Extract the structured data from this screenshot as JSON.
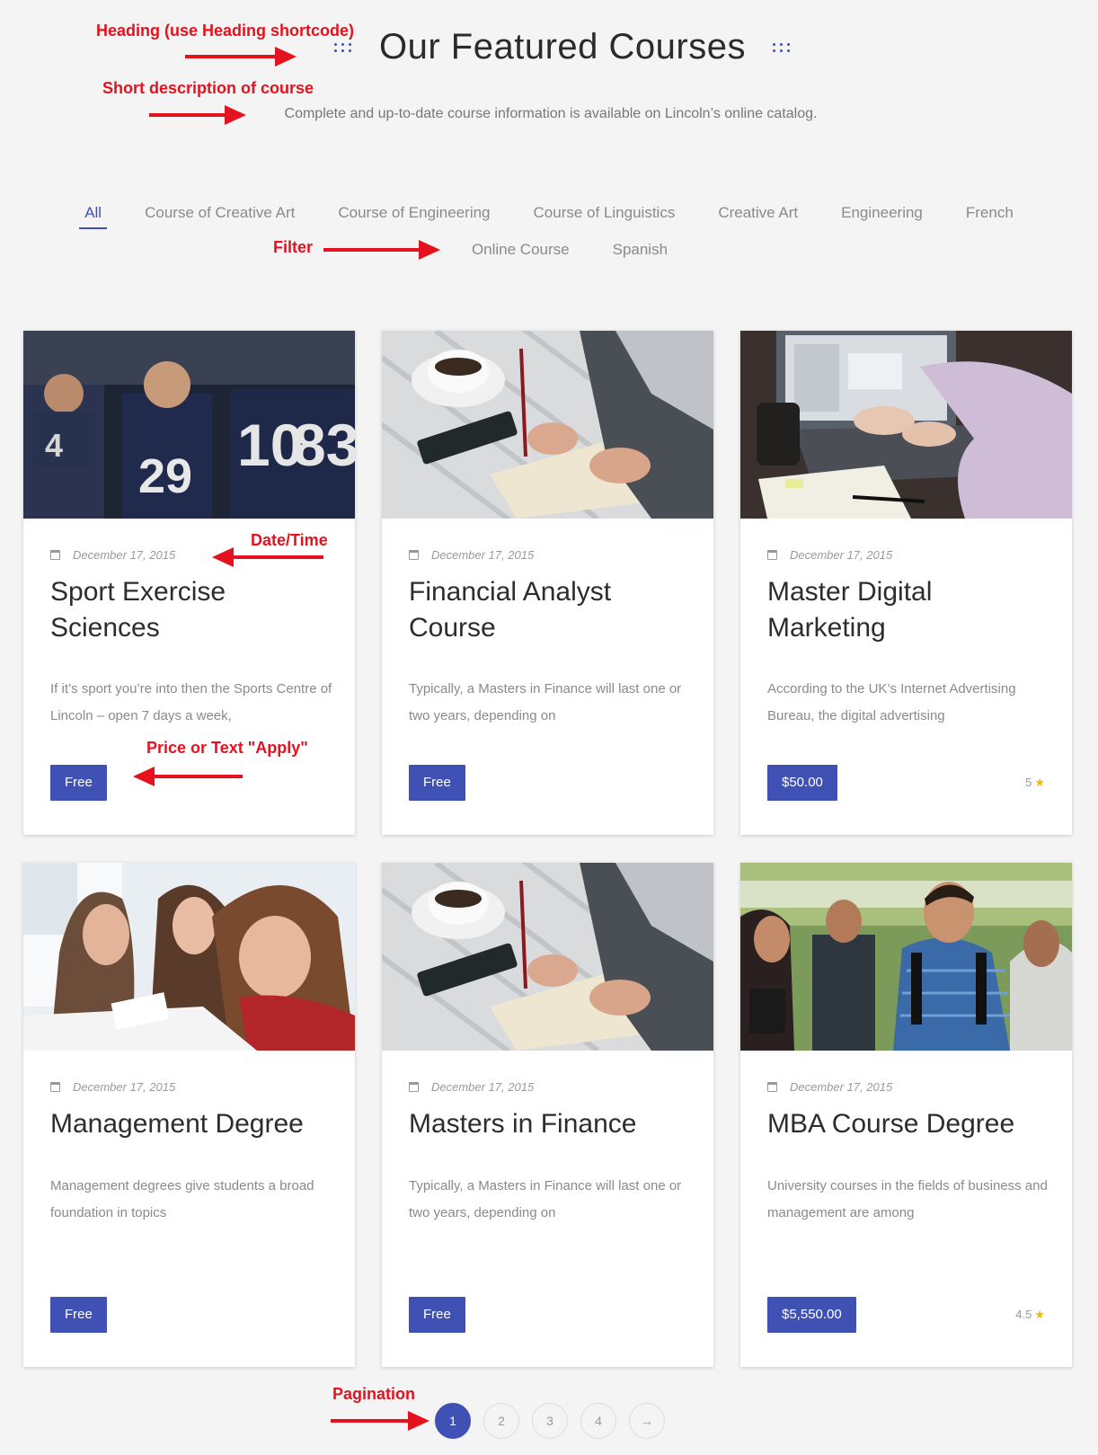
{
  "header": {
    "title": "Our Featured Courses",
    "subtitle": "Complete and up-to-date course information is available on Lincoln’s online catalog."
  },
  "filters": {
    "row1": [
      "All",
      "Course of Creative Art",
      "Course of Engineering",
      "Course of Linguistics",
      "Creative Art",
      "Engineering",
      "French"
    ],
    "row2": [
      "Online Course",
      "Spanish"
    ],
    "active": "All"
  },
  "courses": [
    {
      "image": "football-players-photo",
      "date": "December 17, 2015",
      "title": "Sport Exercise Sciences",
      "description": "If it’s sport you’re into then the Sports Centre of Lincoln – open 7 days a week,",
      "price": "Free",
      "rating": ""
    },
    {
      "image": "writing-notebook-coffee-photo",
      "date": "December 17, 2015",
      "title": "Financial Analyst Course",
      "description": "Typically, a Masters in Finance will last one or two years, depending on",
      "price": "Free",
      "rating": ""
    },
    {
      "image": "laptop-typing-photo",
      "date": "December 17, 2015",
      "title": "Master Digital Marketing",
      "description": "According to the UK’s Internet Advertising Bureau, the digital advertising",
      "price": "$50.00",
      "rating": "5"
    },
    {
      "image": "students-studying-photo",
      "date": "December 17, 2015",
      "title": "Management Degree",
      "description": "Management degrees give students a broad foundation in topics",
      "price": "Free",
      "rating": ""
    },
    {
      "image": "writing-notebook-coffee-photo",
      "date": "December 17, 2015",
      "title": "Masters in Finance",
      "description": "Typically, a Masters in Finance will last one or two years, depending on",
      "price": "Free",
      "rating": ""
    },
    {
      "image": "students-outdoor-photo",
      "date": "December 17, 2015",
      "title": "MBA Course Degree",
      "description": "University courses in the fields of business and management are among",
      "price": "$5,550.00",
      "rating": "4.5"
    }
  ],
  "pagination": {
    "pages": [
      "1",
      "2",
      "3",
      "4"
    ],
    "current": "1",
    "next_icon": "arrow-right-icon",
    "next_label": "→"
  },
  "annotations": {
    "heading": "Heading (use Heading shortcode)",
    "short_description": "Short description of course",
    "filter": "Filter",
    "date_time": "Date/Time",
    "price": "Price or Text \"Apply\"",
    "pagination": "Pagination"
  },
  "colors": {
    "accent": "#3f51b5",
    "annotation": "#e4121e",
    "star": "#f5b800",
    "background": "#f4f4f4"
  }
}
